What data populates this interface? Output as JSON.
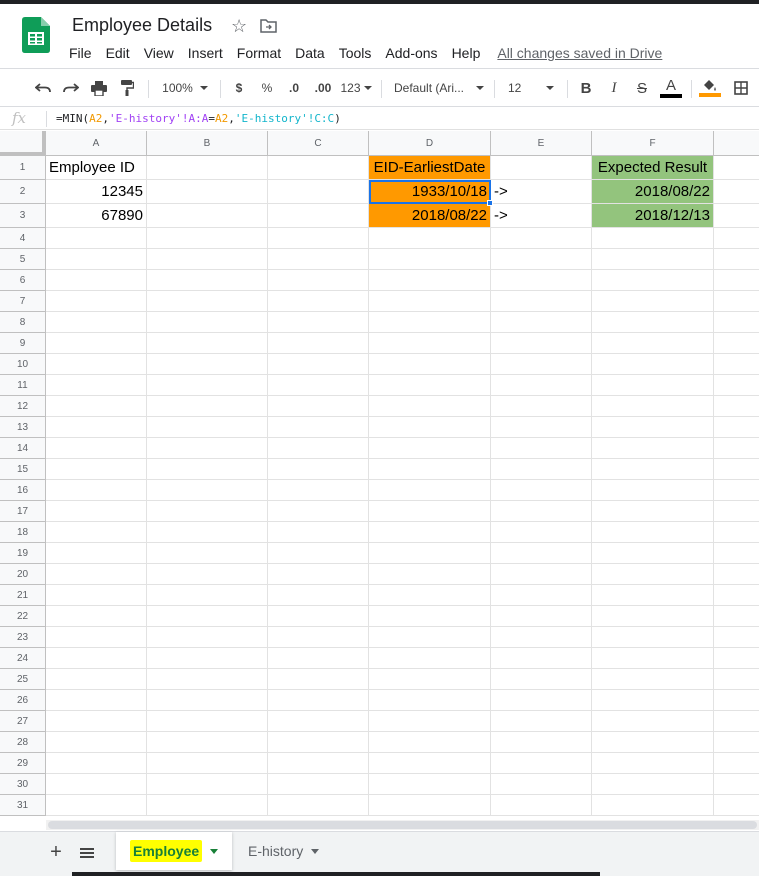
{
  "doc": {
    "title": "Employee Details",
    "saved_status": "All changes saved in Drive"
  },
  "menu": [
    "File",
    "Edit",
    "View",
    "Insert",
    "Format",
    "Data",
    "Tools",
    "Add-ons",
    "Help"
  ],
  "toolbar": {
    "zoom": "100%",
    "currency": "$",
    "percent": "%",
    "decrease_decimal": ".0",
    "increase_decimal": ".00",
    "more_formats": "123",
    "font": "Default (Ari...",
    "font_size": "12",
    "bold": "B",
    "italic": "I",
    "strike": "S",
    "text_color": "A",
    "text_color_value": "#000000",
    "fill_color_value": "#ff9900"
  },
  "formula_bar": {
    "fx_label": "fx",
    "parts": [
      "=MIN(",
      "A2",
      ",",
      "'E-history'!A:A",
      "=",
      "A2",
      ",",
      "'E-history'!C:C",
      ")"
    ]
  },
  "columns": [
    "A",
    "B",
    "C",
    "D",
    "E",
    "F"
  ],
  "rows": [
    "1",
    "2",
    "3",
    "4",
    "5",
    "6",
    "7",
    "8",
    "9",
    "10",
    "11",
    "12",
    "13",
    "14",
    "15",
    "16",
    "17",
    "18",
    "19",
    "20",
    "21",
    "22",
    "23",
    "24",
    "25",
    "26",
    "27",
    "28",
    "29",
    "30",
    "31"
  ],
  "cells": {
    "A1": "Employee ID",
    "A2": "12345",
    "A3": "67890",
    "D1": "EID-EarliestDate",
    "D2": "1933/10/18",
    "D3": "2018/08/22",
    "E2": "->",
    "E3": "->",
    "F1": "Expected Result",
    "F2": "2018/08/22",
    "F3": "2018/12/13"
  },
  "fill_colors": {
    "orange": "#ff9900",
    "green": "#93c47d",
    "selection": "#1a73e8",
    "highlight": "#ffff00"
  },
  "sheets": {
    "active": "Employee",
    "other": "E-history"
  }
}
